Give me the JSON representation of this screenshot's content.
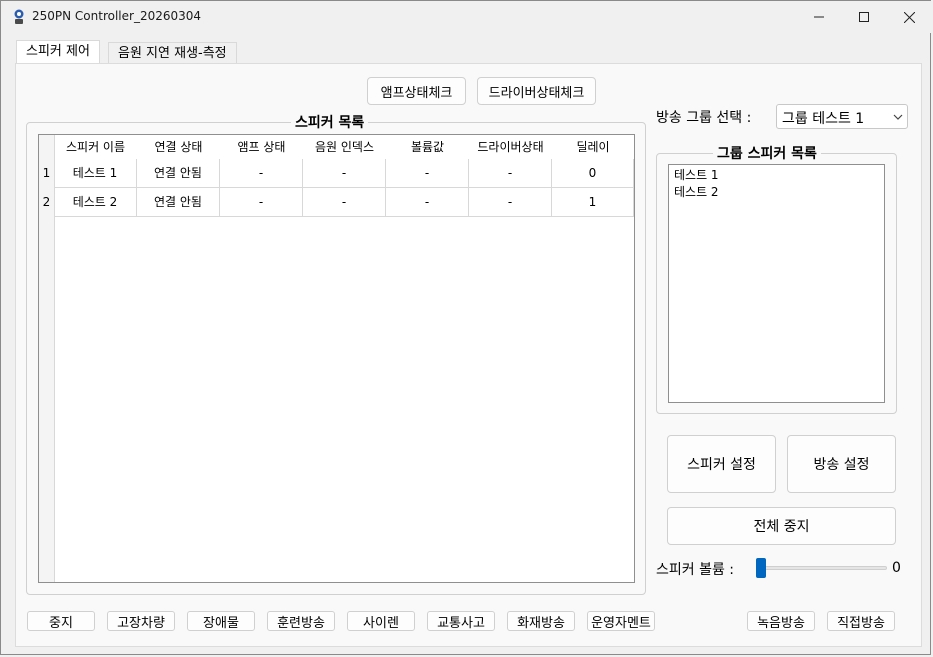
{
  "window": {
    "title": "250PN Controller_20260304",
    "minimize_icon": "minimize-icon",
    "maximize_icon": "maximize-icon",
    "close_icon": "close-icon"
  },
  "tabs": [
    {
      "label": "스피커 제어",
      "active": true
    },
    {
      "label": "음원 지연 재생-측정",
      "active": false
    }
  ],
  "top_buttons": {
    "amp_check": "앰프상태체크",
    "driver_check": "드라이버상태체크"
  },
  "speaker_list": {
    "title": "스피커 목록",
    "columns": [
      "스피커 이름",
      "연결 상태",
      "앰프 상태",
      "음원 인덱스",
      "볼륨값",
      "드라이버상태",
      "딜레이"
    ],
    "rows": [
      {
        "index": "1",
        "cells": [
          "테스트 1",
          "연결 안됨",
          "-",
          "-",
          "-",
          "-",
          "0"
        ]
      },
      {
        "index": "2",
        "cells": [
          "테스트 2",
          "연결 안됨",
          "-",
          "-",
          "-",
          "-",
          "1"
        ]
      }
    ]
  },
  "broadcast_group": {
    "label": "방송 그룹 선택 :",
    "selected": "그룹 테스트 1"
  },
  "group_speakers": {
    "title": "그룹 스피커 목록",
    "items": [
      "테스트 1",
      "테스트 2"
    ]
  },
  "settings_buttons": {
    "speaker_settings": "스피커 설정",
    "broadcast_settings": "방송 설정",
    "stop_all": "전체 중지"
  },
  "volume": {
    "label": "스피커 볼륨 :",
    "value": "0",
    "level": 0
  },
  "bottom_buttons": [
    "중지",
    "고장차량",
    "장애물",
    "훈련방송",
    "사이렌",
    "교통사고",
    "화재방송",
    "운영자멘트"
  ],
  "bottom_right_buttons": [
    "녹음방송",
    "직접방송"
  ]
}
